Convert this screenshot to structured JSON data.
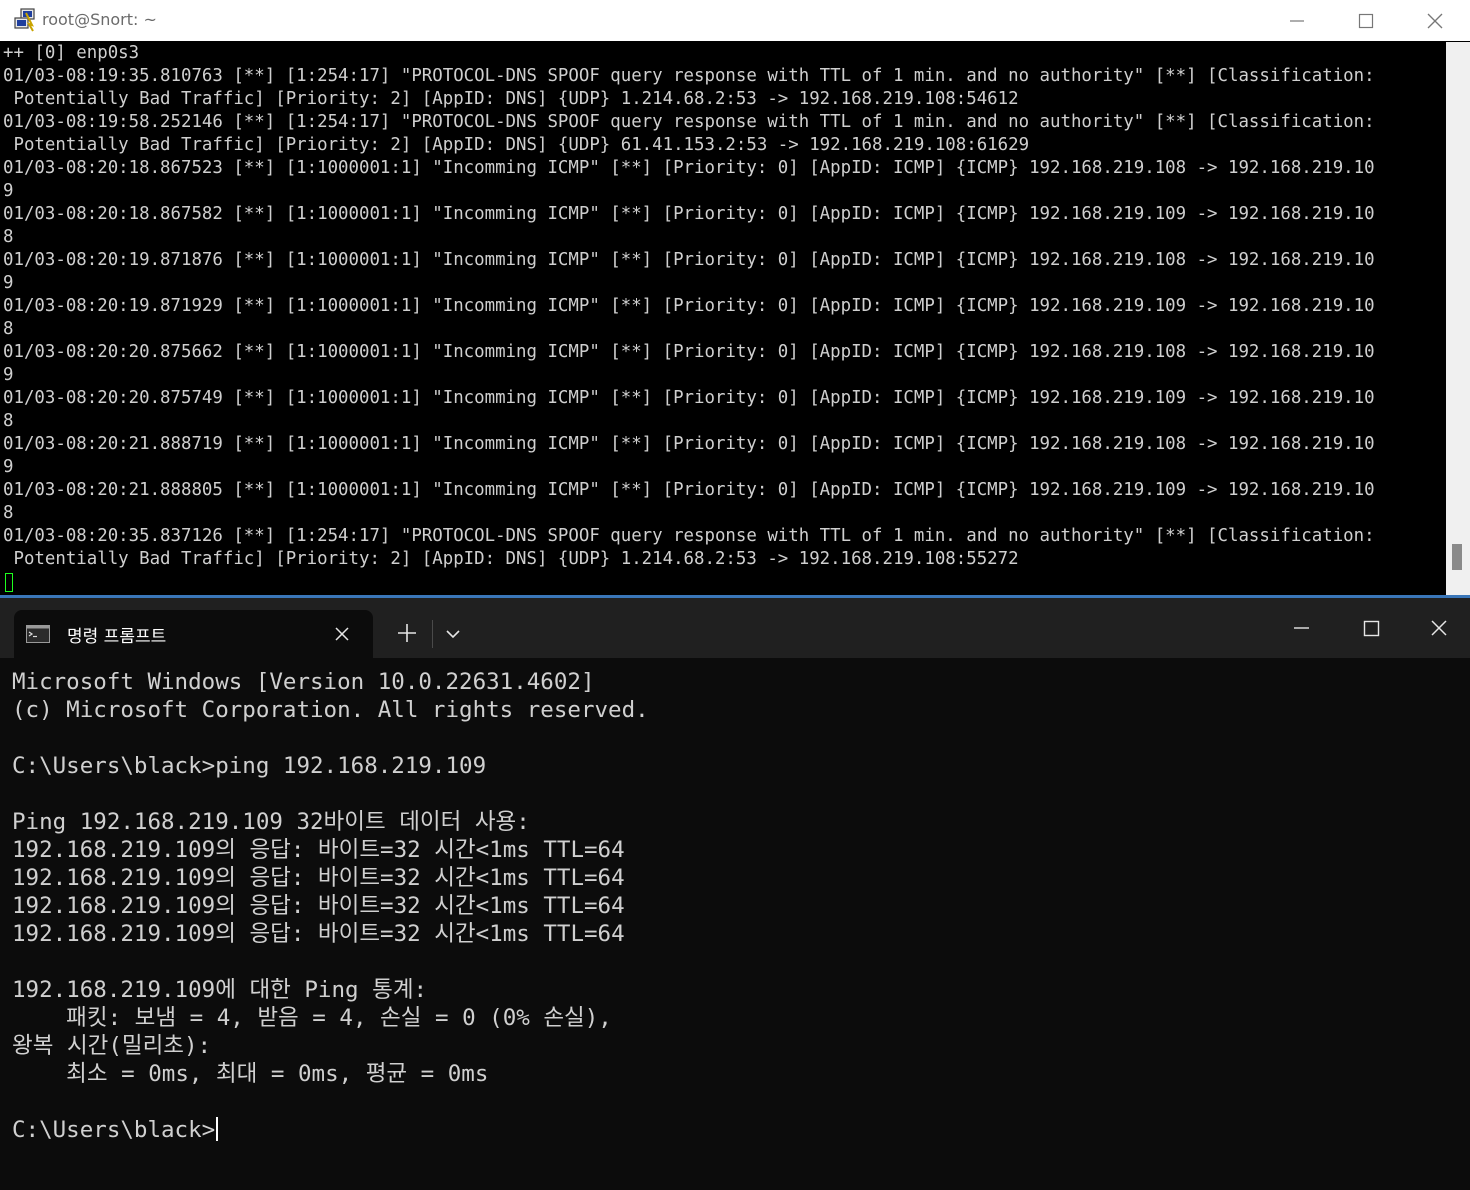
{
  "putty": {
    "title": "root@Snort: ~",
    "terminal_lines": [
      "++ [0] enp0s3",
      "01/03-08:19:35.810763 [**] [1:254:17] \"PROTOCOL-DNS SPOOF query response with TTL of 1 min. and no authority\" [**] [Classification:",
      " Potentially Bad Traffic] [Priority: 2] [AppID: DNS] {UDP} 1.214.68.2:53 -> 192.168.219.108:54612",
      "01/03-08:19:58.252146 [**] [1:254:17] \"PROTOCOL-DNS SPOOF query response with TTL of 1 min. and no authority\" [**] [Classification:",
      " Potentially Bad Traffic] [Priority: 2] [AppID: DNS] {UDP} 61.41.153.2:53 -> 192.168.219.108:61629",
      "01/03-08:20:18.867523 [**] [1:1000001:1] \"Incomming ICMP\" [**] [Priority: 0] [AppID: ICMP] {ICMP} 192.168.219.108 -> 192.168.219.10",
      "9",
      "01/03-08:20:18.867582 [**] [1:1000001:1] \"Incomming ICMP\" [**] [Priority: 0] [AppID: ICMP] {ICMP} 192.168.219.109 -> 192.168.219.10",
      "8",
      "01/03-08:20:19.871876 [**] [1:1000001:1] \"Incomming ICMP\" [**] [Priority: 0] [AppID: ICMP] {ICMP} 192.168.219.108 -> 192.168.219.10",
      "9",
      "01/03-08:20:19.871929 [**] [1:1000001:1] \"Incomming ICMP\" [**] [Priority: 0] [AppID: ICMP] {ICMP} 192.168.219.109 -> 192.168.219.10",
      "8",
      "01/03-08:20:20.875662 [**] [1:1000001:1] \"Incomming ICMP\" [**] [Priority: 0] [AppID: ICMP] {ICMP} 192.168.219.108 -> 192.168.219.10",
      "9",
      "01/03-08:20:20.875749 [**] [1:1000001:1] \"Incomming ICMP\" [**] [Priority: 0] [AppID: ICMP] {ICMP} 192.168.219.109 -> 192.168.219.10",
      "8",
      "01/03-08:20:21.888719 [**] [1:1000001:1] \"Incomming ICMP\" [**] [Priority: 0] [AppID: ICMP] {ICMP} 192.168.219.108 -> 192.168.219.10",
      "9",
      "01/03-08:20:21.888805 [**] [1:1000001:1] \"Incomming ICMP\" [**] [Priority: 0] [AppID: ICMP] {ICMP} 192.168.219.109 -> 192.168.219.10",
      "8",
      "01/03-08:20:35.837126 [**] [1:254:17] \"PROTOCOL-DNS SPOOF query response with TTL of 1 min. and no authority\" [**] [Classification:",
      " Potentially Bad Traffic] [Priority: 2] [AppID: DNS] {UDP} 1.214.68.2:53 -> 192.168.219.108:55272"
    ],
    "colors": {
      "terminal_bg": "#000000",
      "terminal_fg": "#cfcfcf",
      "cursor": "#1eff1e",
      "titlebar_bg": "#ffffff"
    },
    "icons": {
      "app": "putty-app-icon",
      "minimize": "minimize-icon",
      "maximize": "maximize-icon",
      "close": "close-icon"
    }
  },
  "cmd": {
    "tab_title": "명령 프롬프트",
    "terminal_lines": [
      "Microsoft Windows [Version 10.0.22631.4602]",
      "(c) Microsoft Corporation. All rights reserved.",
      "",
      "C:\\Users\\black>ping 192.168.219.109",
      "",
      "Ping 192.168.219.109 32바이트 데이터 사용:",
      "192.168.219.109의 응답: 바이트=32 시간<1ms TTL=64",
      "192.168.219.109의 응답: 바이트=32 시간<1ms TTL=64",
      "192.168.219.109의 응답: 바이트=32 시간<1ms TTL=64",
      "192.168.219.109의 응답: 바이트=32 시간<1ms TTL=64",
      "",
      "192.168.219.109에 대한 Ping 통계:",
      "    패킷: 보냄 = 4, 받음 = 4, 손실 = 0 (0% 손실),",
      "왕복 시간(밀리초):",
      "    최소 = 0ms, 최대 = 0ms, 평균 = 0ms",
      ""
    ],
    "prompt": "C:\\Users\\black>",
    "colors": {
      "terminal_bg": "#0c0c0c",
      "terminal_fg": "#d0d0d0",
      "tabbar_bg": "#202020",
      "active_tab_bg": "#0c0c0c"
    },
    "icons": {
      "tab": "cmd-tab-icon",
      "tab_close": "close-icon",
      "new_tab": "plus-icon",
      "dropdown": "chevron-down-icon",
      "minimize": "minimize-icon",
      "maximize": "maximize-icon",
      "close": "close-icon"
    }
  }
}
